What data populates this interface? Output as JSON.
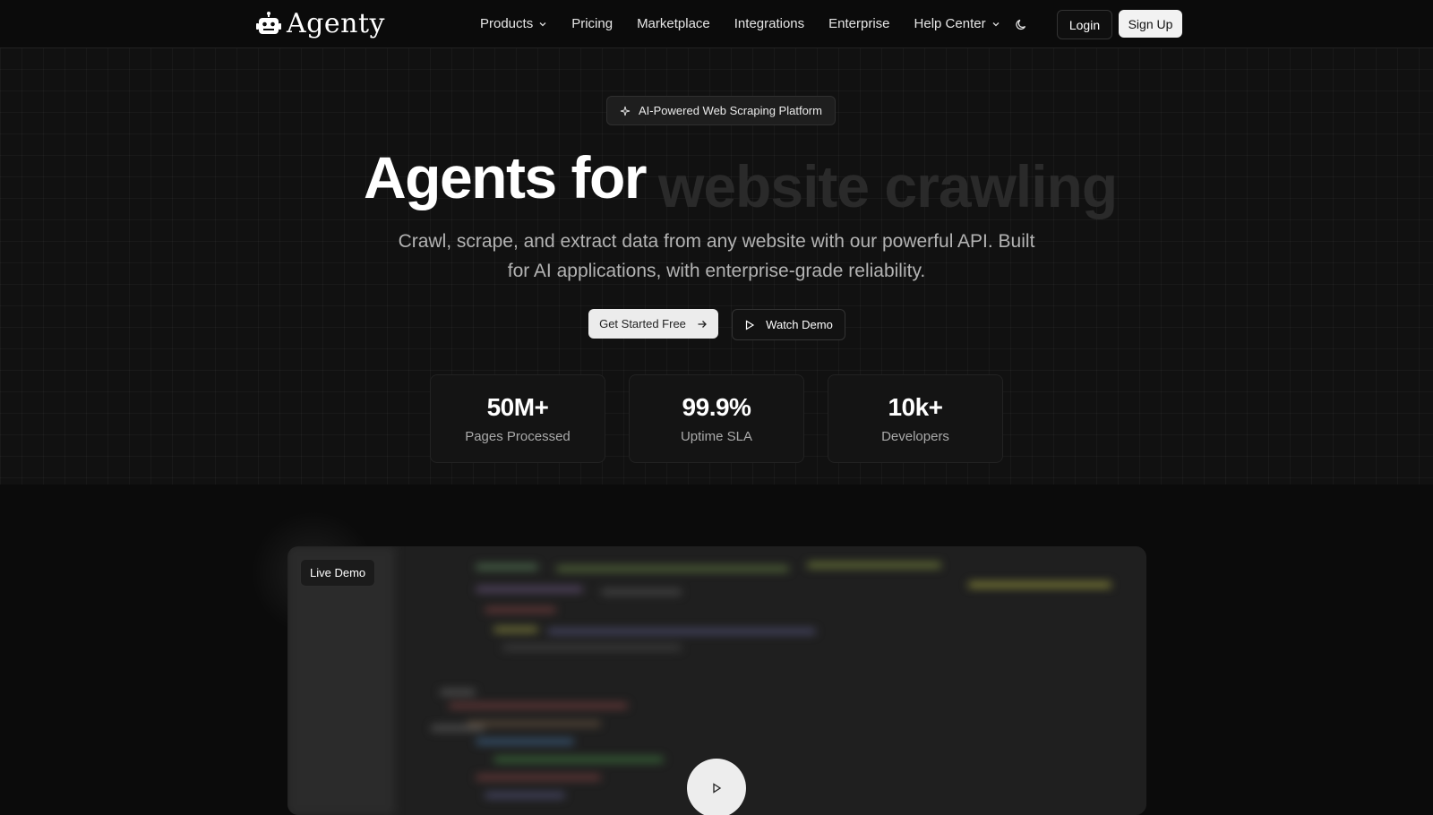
{
  "brand": {
    "name": "Agenty"
  },
  "nav": {
    "links": [
      {
        "label": "Products",
        "dropdown": true
      },
      {
        "label": "Pricing",
        "dropdown": false
      },
      {
        "label": "Marketplace",
        "dropdown": false
      },
      {
        "label": "Integrations",
        "dropdown": false
      },
      {
        "label": "Enterprise",
        "dropdown": false
      },
      {
        "label": "Help Center",
        "dropdown": true
      }
    ],
    "theme_icon": "moon-icon",
    "login_label": "Login",
    "signup_label": "Sign Up"
  },
  "hero": {
    "badge": "AI-Powered Web Scraping Platform",
    "headline_main": "Agents for",
    "headline_rotating": "website crawling",
    "subtitle": "Crawl, scrape, and extract data from any website with our powerful API. Built for AI applications, with enterprise-grade reliability.",
    "cta_primary": "Get Started Free",
    "cta_secondary": "Watch Demo"
  },
  "stats": [
    {
      "value": "50M+",
      "label": "Pages Processed"
    },
    {
      "value": "99.9%",
      "label": "Uptime SLA"
    },
    {
      "value": "10k+",
      "label": "Developers"
    }
  ],
  "demo": {
    "badge": "Live Demo"
  },
  "colors": {
    "background": "#0b0b0b",
    "accent": "#f2f2f2"
  }
}
